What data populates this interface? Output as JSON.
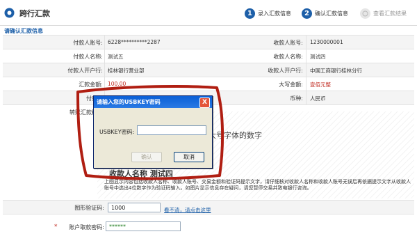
{
  "header": {
    "title": "跨行汇款",
    "steps": [
      {
        "num": "1",
        "label": "录入汇款信息"
      },
      {
        "num": "2",
        "label": "确认汇款信息"
      },
      {
        "num": "",
        "label": "查看汇款结果"
      }
    ]
  },
  "section_title": "请确认汇款信息",
  "form": {
    "payer_account_label": "付款人账号:",
    "payer_account": "6228**********2287",
    "payee_account_label": "收款人账号:",
    "payee_account": "1230000001",
    "payer_name_label": "付款人名称:",
    "payer_name": "测试五",
    "payee_name_label": "收款人名称:",
    "payee_name": "测试四",
    "payer_bank_label": "付款人开户行:",
    "payer_bank": "桂林银行营业部",
    "payee_bank_label": "收款人开户行:",
    "payee_bank": "中国工商银行桂林分行",
    "amount_label": "汇款金额:",
    "amount": "100.00",
    "amount_upper_label": "大写金额:",
    "amount_upper": "壹佰元整",
    "fee_label": "付款用",
    "currency_label": "币种:",
    "currency": "人民币",
    "transfer_label": "转账汇款模式"
  },
  "captcha": {
    "big_text": "大号字体的数字",
    "payee_name_line": "收款人名称 测试四",
    "note": "上图显示内容包括收款人名称、收款人账号、交易金额和验证码提示文字，请仔细核对收款人名称和收款人账号无误后再依据提示文字从收款人账号中选出4位数字作为验证码输入。如图片显示信息存在疑问，请您暂停交易并致电银行咨询。",
    "code_label": "图形验证码:",
    "code_value": "1000",
    "refresh_text": "看不清，请点击这里"
  },
  "password": {
    "required_mark": "*",
    "label": "账户取款密码:",
    "value": "******"
  },
  "dialog": {
    "title": "请输入您的USBKEY密码",
    "close": "X",
    "field_label": "USBKEY密码:",
    "field_value": "",
    "ok_label": "确认",
    "cancel_label": "取消"
  },
  "colors": {
    "accent": "#1d5fa8",
    "annotation": "#b01e12",
    "dialog_title": "#0a5fd6"
  }
}
